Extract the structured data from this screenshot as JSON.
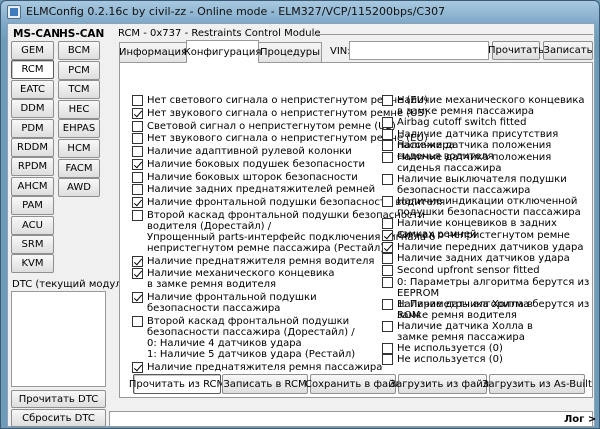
{
  "window": {
    "title": "ELMConfig 0.2.16c by civil-zz - Online mode - ELM327/VCP/115200bps/C307"
  },
  "ms_can": {
    "header": "MS-CAN",
    "buttons": [
      "GEM",
      "RCM",
      "EATC",
      "DDM",
      "PDM",
      "RDDM",
      "RPDM",
      "AHCM",
      "PAM",
      "ACU",
      "SRM",
      "KVM"
    ],
    "selected": "RCM"
  },
  "hs_can": {
    "header": "HS-CAN",
    "buttons": [
      "BCM",
      "PCM",
      "TCM",
      "HEC",
      "EHPAS",
      "HCM",
      "FACM",
      "AWD"
    ]
  },
  "dtc": {
    "label": "DTC (текущий модуль):",
    "read_button": "Прочитать DTC",
    "reset_button": "Сбросить DTC"
  },
  "module": {
    "title": "RCM - 0x737 - Restraints Control Module"
  },
  "tabs": [
    "Информация",
    "Конфигурация",
    "Процедуры"
  ],
  "active_tab": "Конфигурация",
  "vin": {
    "label": "VIN:",
    "value": "",
    "read_button": "Прочитать",
    "write_button": "Записать"
  },
  "options_left": [
    {
      "label": "Нет светового сигнала о непристегнутом ремне (EU)",
      "checked": false
    },
    {
      "label": "Нет звукового сигнала о непристегнутом ремне (US)",
      "checked": true
    },
    {
      "label": "Световой сигнал о непристегнутом ремне (US)",
      "checked": false
    },
    {
      "label": "Нет звукового сигнала о непристегнутом ремне (EU)",
      "checked": false
    },
    {
      "label": "Наличие адаптивной рулевой колонки",
      "checked": false
    },
    {
      "label": "Наличие боковых подушек безопасности",
      "checked": true
    },
    {
      "label": "Наличие боковых шторок безопасности",
      "checked": false
    },
    {
      "label": "Наличие задних преднатяжителей ремней",
      "checked": false
    },
    {
      "label": "Наличие фронтальной подушки безопасности водителя",
      "checked": true
    },
    {
      "label": "Второй каскад фронтальной подушки безопасности\nводителя (Дорестайл) /\nУпрощенный parts-интерфейс подключения сигнала о\nнепристегнутом ремне пассажира (Рестайл)",
      "checked": false
    },
    {
      "label": "Наличие преднатяжителя ремня водителя",
      "checked": true
    },
    {
      "label": "Наличие механического концевика\nв замке ремня водителя",
      "checked": true
    },
    {
      "label": "Наличие фронтальной подушки\nбезопасности пассажира",
      "checked": true
    },
    {
      "label": "Второй каскад фронтальной подушки\nбезопасности пассажира (Дорестайл) /\n0: Наличие 4 датчиков удара\n1: Наличие 5 датчиков удара (Рестайл)",
      "checked": false
    },
    {
      "label": "Наличие преднатяжителя ремня пассажира",
      "checked": true
    }
  ],
  "options_right": [
    {
      "label": "Наличие механического концевика\nв замке ремня пассажира",
      "checked": false
    },
    {
      "label": "Airbag cutoff switch fitted",
      "checked": false
    },
    {
      "label": "Наличие датчика присутствия пассажира",
      "checked": false
    },
    {
      "label": "Наличие датчика положения сиденья водителя",
      "checked": false
    },
    {
      "label": "Наличие датчика положения\nсиденья пассажира",
      "checked": false
    },
    {
      "label": "Наличие выключателя подушки\nбезопасности пассажира",
      "checked": false
    },
    {
      "label": "Наличие индикации отключенной\nподушки безопасности пассажира",
      "checked": false
    },
    {
      "label": "Наличие концевиков в задних замках ремней",
      "checked": false
    },
    {
      "label": "Сигнал о непристегнутом ремне",
      "checked": true
    },
    {
      "label": "Наличие передних датчиков удара",
      "checked": true
    },
    {
      "label": "Наличие задних датчиков удара",
      "checked": false
    },
    {
      "label": "Second upfront sensor fitted",
      "checked": false
    },
    {
      "label": "0: Параметры алгоритма берутся из EEPROM\n1: Параметры алгоритма берутся из ROM",
      "checked": false
    },
    {
      "label": "Наличие датчика Холла в\nзамке ремня водителя",
      "checked": false
    },
    {
      "label": "Наличие датчика Холла в\nзамке ремня пассажира",
      "checked": false
    },
    {
      "label": "Не используется (0)",
      "checked": false
    },
    {
      "label": "Не используется (0)",
      "checked": false
    }
  ],
  "actions": [
    "Прочитать из RCM",
    "Записать в RCM",
    "Сохранить в файл",
    "Загрузить из файла",
    "Загрузить из As-Built"
  ],
  "log_button": "Лог >"
}
